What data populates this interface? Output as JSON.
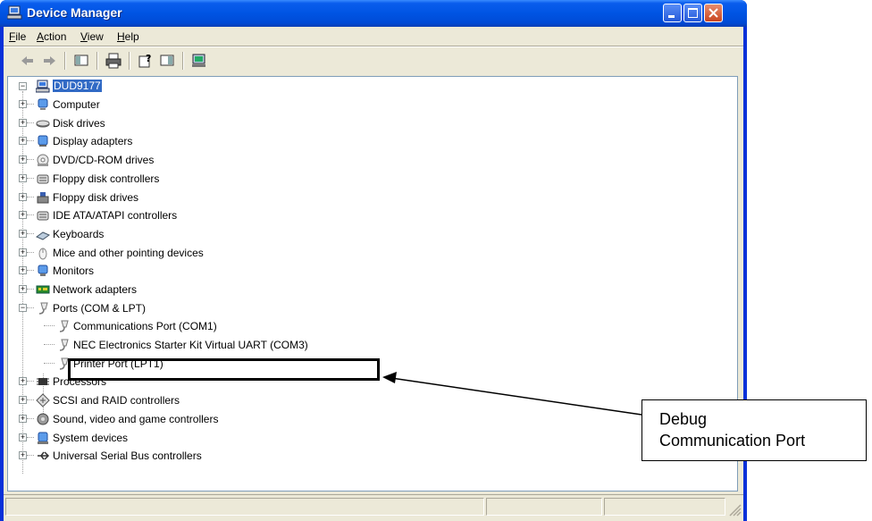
{
  "window": {
    "title": "Device Manager",
    "controls": [
      "minimize",
      "maximize",
      "close"
    ]
  },
  "menubar": {
    "items": [
      {
        "key": "F",
        "rest": "ile"
      },
      {
        "key": "A",
        "rest": "ction"
      },
      {
        "key": "V",
        "rest": "iew"
      },
      {
        "key": "H",
        "rest": "elp"
      }
    ]
  },
  "toolbar": {
    "buttons": [
      "back-icon",
      "forward-icon",
      "show-hide-tree-icon",
      "print-icon",
      "properties-icon",
      "help-icon",
      "scan-hardware-icon"
    ]
  },
  "tree": {
    "root": "DUD9177",
    "categories": [
      {
        "label": "Computer",
        "icon": "computer-icon"
      },
      {
        "label": "Disk drives",
        "icon": "disk-drive-icon"
      },
      {
        "label": "Display adapters",
        "icon": "display-adapter-icon"
      },
      {
        "label": "DVD/CD-ROM drives",
        "icon": "dvd-icon"
      },
      {
        "label": "Floppy disk controllers",
        "icon": "controller-icon"
      },
      {
        "label": "Floppy disk drives",
        "icon": "floppy-icon"
      },
      {
        "label": "IDE ATA/ATAPI controllers",
        "icon": "controller-icon"
      },
      {
        "label": "Keyboards",
        "icon": "keyboard-icon"
      },
      {
        "label": "Mice and other pointing devices",
        "icon": "mouse-icon"
      },
      {
        "label": "Monitors",
        "icon": "monitor-icon"
      },
      {
        "label": "Network adapters",
        "icon": "network-icon"
      },
      {
        "label": "Ports (COM & LPT)",
        "icon": "port-icon",
        "expanded": true,
        "children": [
          {
            "label": "Communications Port (COM1)",
            "icon": "port-icon"
          },
          {
            "label": "NEC Electronics Starter Kit Virtual UART (COM3)",
            "icon": "port-icon",
            "highlighted": true
          },
          {
            "label": "Printer Port (LPT1)",
            "icon": "port-icon"
          }
        ]
      },
      {
        "label": "Processors",
        "icon": "processor-icon"
      },
      {
        "label": "SCSI and RAID controllers",
        "icon": "scsi-icon"
      },
      {
        "label": "Sound, video and game controllers",
        "icon": "sound-icon"
      },
      {
        "label": "System devices",
        "icon": "system-icon"
      },
      {
        "label": "Universal Serial Bus controllers",
        "icon": "usb-icon"
      }
    ]
  },
  "annotation": {
    "line1": "Debug",
    "line2": "Communication Port"
  },
  "colors": {
    "titlebar": "#0054e3",
    "selection": "#316ac5",
    "window_bg": "#ece9d8"
  }
}
